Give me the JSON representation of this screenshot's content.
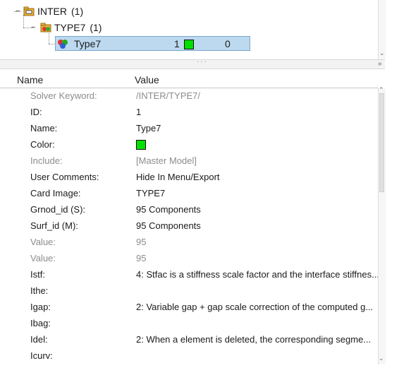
{
  "tree": {
    "inter": {
      "label": "INTER",
      "count": "(1)"
    },
    "type7_group": {
      "label": "TYPE7",
      "count": "(1)"
    },
    "type7_item": {
      "label": "Type7",
      "id": "1",
      "value": "0"
    }
  },
  "table": {
    "header": {
      "name": "Name",
      "value": "Value"
    },
    "rows": [
      {
        "key": "Solver Keyword:",
        "value": "/INTER/TYPE7/",
        "dim": true
      },
      {
        "key": "ID:",
        "value": "1",
        "dim": false
      },
      {
        "key": "Name:",
        "value": "Type7",
        "dim": false
      },
      {
        "key": "Color:",
        "value": "",
        "dim": false,
        "swatch": "#00e000"
      },
      {
        "key": "Include:",
        "value": "[Master Model]",
        "dim": true
      },
      {
        "key": "User Comments:",
        "value": "Hide In Menu/Export",
        "dim": false
      },
      {
        "key": "Card Image:",
        "value": "TYPE7",
        "dim": false
      },
      {
        "key": "Grnod_id (S):",
        "value": "95 Components",
        "dim": false
      },
      {
        "key": "Surf_id (M):",
        "value": "95 Components",
        "dim": false
      },
      {
        "key": "Value:",
        "value": "95",
        "dim": true
      },
      {
        "key": "Value:",
        "value": "95",
        "dim": true
      },
      {
        "key": "Istf:",
        "value": "4: Stfac is a stiffness scale factor and the interface stiffnes...",
        "dim": false
      },
      {
        "key": "Ithe:",
        "value": "",
        "dim": false
      },
      {
        "key": "Igap:",
        "value": "2: Variable gap + gap scale correction of the computed g...",
        "dim": false
      },
      {
        "key": "Ibag:",
        "value": "",
        "dim": false
      },
      {
        "key": "Idel:",
        "value": "2: When a element is deleted, the corresponding segme...",
        "dim": false
      },
      {
        "key": "Icurv:",
        "value": "",
        "dim": false
      }
    ]
  },
  "colors": {
    "selection": "#bcd9ef",
    "swatch": "#00e000",
    "dim_text": "#8c8c8c"
  }
}
